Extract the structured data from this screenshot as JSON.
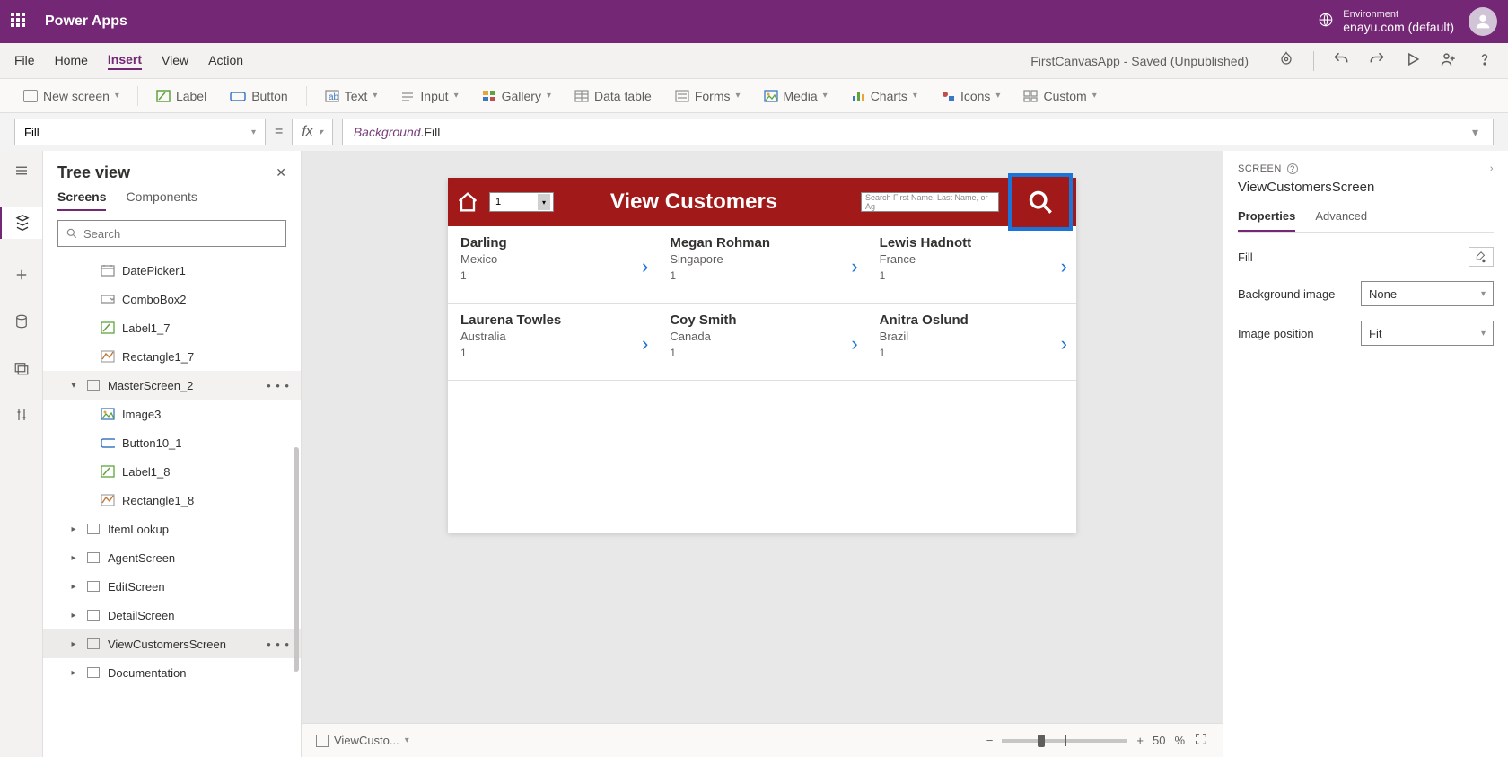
{
  "header": {
    "app_title": "Power Apps",
    "env_label": "Environment",
    "env_name": "enayu.com (default)"
  },
  "menu": {
    "items": [
      "File",
      "Home",
      "Insert",
      "View",
      "Action"
    ],
    "active": "Insert",
    "app_status": "FirstCanvasApp - Saved (Unpublished)"
  },
  "ribbon": {
    "new_screen": "New screen",
    "label": "Label",
    "button": "Button",
    "text": "Text",
    "input": "Input",
    "gallery": "Gallery",
    "data_table": "Data table",
    "forms": "Forms",
    "media": "Media",
    "charts": "Charts",
    "icons": "Icons",
    "custom": "Custom"
  },
  "formula": {
    "property": "Fill",
    "fx": "fx",
    "token1": "Background",
    "token2": ".Fill"
  },
  "tree": {
    "title": "Tree view",
    "tabs": {
      "screens": "Screens",
      "components": "Components"
    },
    "search_placeholder": "Search",
    "items": [
      {
        "label": "DatePicker1",
        "icon": "datepicker",
        "depth": 2
      },
      {
        "label": "ComboBox2",
        "icon": "combo",
        "depth": 2
      },
      {
        "label": "Label1_7",
        "icon": "label",
        "depth": 2
      },
      {
        "label": "Rectangle1_7",
        "icon": "rect",
        "depth": 2
      },
      {
        "label": "MasterScreen_2",
        "icon": "screen",
        "depth": 1,
        "expanded": true,
        "hovered": true,
        "more": true
      },
      {
        "label": "Image3",
        "icon": "image",
        "depth": 2
      },
      {
        "label": "Button10_1",
        "icon": "button",
        "depth": 2
      },
      {
        "label": "Label1_8",
        "icon": "label",
        "depth": 2
      },
      {
        "label": "Rectangle1_8",
        "icon": "rect",
        "depth": 2
      },
      {
        "label": "ItemLookup",
        "icon": "screen",
        "depth": 1,
        "caret": true
      },
      {
        "label": "AgentScreen",
        "icon": "screen",
        "depth": 1,
        "caret": true
      },
      {
        "label": "EditScreen",
        "icon": "screen",
        "depth": 1,
        "caret": true
      },
      {
        "label": "DetailScreen",
        "icon": "screen",
        "depth": 1,
        "caret": true
      },
      {
        "label": "ViewCustomersScreen",
        "icon": "screen",
        "depth": 1,
        "caret": true,
        "selected": true,
        "more": true
      },
      {
        "label": "Documentation",
        "icon": "screen",
        "depth": 1,
        "caret": true
      }
    ]
  },
  "canvas": {
    "screen_title": "View Customers",
    "combo_value": "1",
    "search_placeholder": "Search First Name, Last Name, or Ag",
    "customers": [
      {
        "name": "Darling",
        "country": "Mexico",
        "num": "1"
      },
      {
        "name": "Megan  Rohman",
        "country": "Singapore",
        "num": "1"
      },
      {
        "name": "Lewis  Hadnott",
        "country": "France",
        "num": "1"
      },
      {
        "name": "Laurena  Towles",
        "country": "Australia",
        "num": "1"
      },
      {
        "name": "Coy  Smith",
        "country": "Canada",
        "num": "1"
      },
      {
        "name": "Anitra  Oslund",
        "country": "Brazil",
        "num": "1"
      }
    ],
    "bottom": {
      "screen_sel": "ViewCusto...",
      "zoom": "50",
      "pct": "%"
    }
  },
  "props": {
    "section": "SCREEN",
    "name": "ViewCustomersScreen",
    "tabs": {
      "properties": "Properties",
      "advanced": "Advanced"
    },
    "fill": "Fill",
    "bg_image": "Background image",
    "bg_image_val": "None",
    "img_pos": "Image position",
    "img_pos_val": "Fit"
  }
}
